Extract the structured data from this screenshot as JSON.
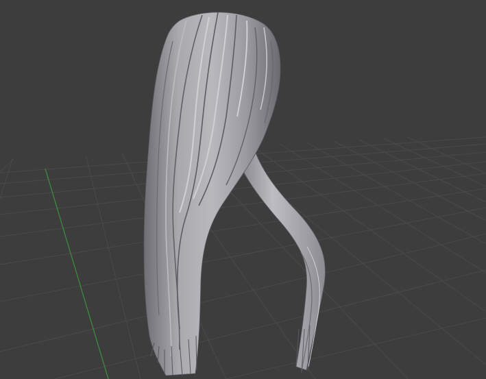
{
  "viewport": {
    "background": "#3d3d3d",
    "grid_line_color": "#4a4a4a",
    "y_axis_color": "#3f8a3f",
    "mesh_base_color": "#9a9aa0",
    "mesh_light_color": "#c4c4c9",
    "mesh_shadow_color": "#55555b",
    "object": "hair-mesh"
  }
}
